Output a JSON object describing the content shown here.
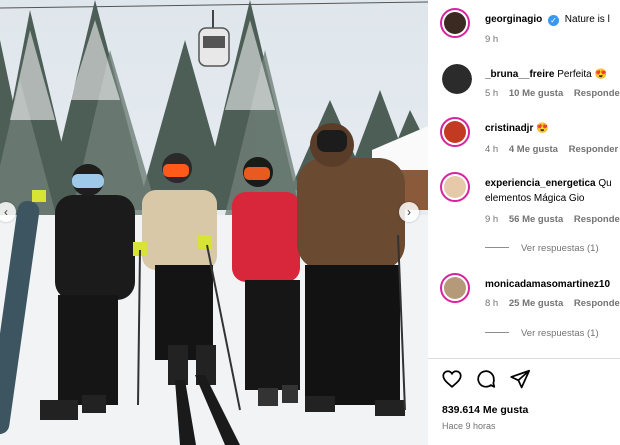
{
  "post": {
    "author": "georginagio",
    "caption": "Nature is l",
    "time": "9 h",
    "verified_glyph": "✓"
  },
  "comments": [
    {
      "user": "_bruna__freire",
      "text": "Perfeita 😍",
      "time": "5 h",
      "likes": "10 Me gusta",
      "reply": "Responder"
    },
    {
      "user": "cristinadjr",
      "text": "😍",
      "time": "4 h",
      "likes": "4 Me gusta",
      "reply": "Responder"
    },
    {
      "user": "experiencia_energetica",
      "text": "Qu",
      "text2": "elementos Mágica Gio",
      "time": "9 h",
      "likes": "56 Me gusta",
      "reply": "Responder",
      "view_replies": "Ver respuestas (1)"
    },
    {
      "user": "monicadamasomartinez10",
      "text": "",
      "time": "8 h",
      "likes": "25 Me gusta",
      "reply": "Responder",
      "view_replies": "Ver respuestas (1)"
    }
  ],
  "footer": {
    "likes": "839.614 Me gusta",
    "time_ago": "Hace 9 horas"
  },
  "icons": {
    "like": "heart-icon",
    "comment": "comment-icon",
    "share": "send-icon",
    "prev": "chevron-left-icon",
    "next": "chevron-right-icon"
  },
  "nav": {
    "prev_glyph": "‹",
    "next_glyph": "›"
  },
  "colors": {
    "story_ring": "#d6249f",
    "verified": "#3897f0",
    "muted": "#737373"
  }
}
